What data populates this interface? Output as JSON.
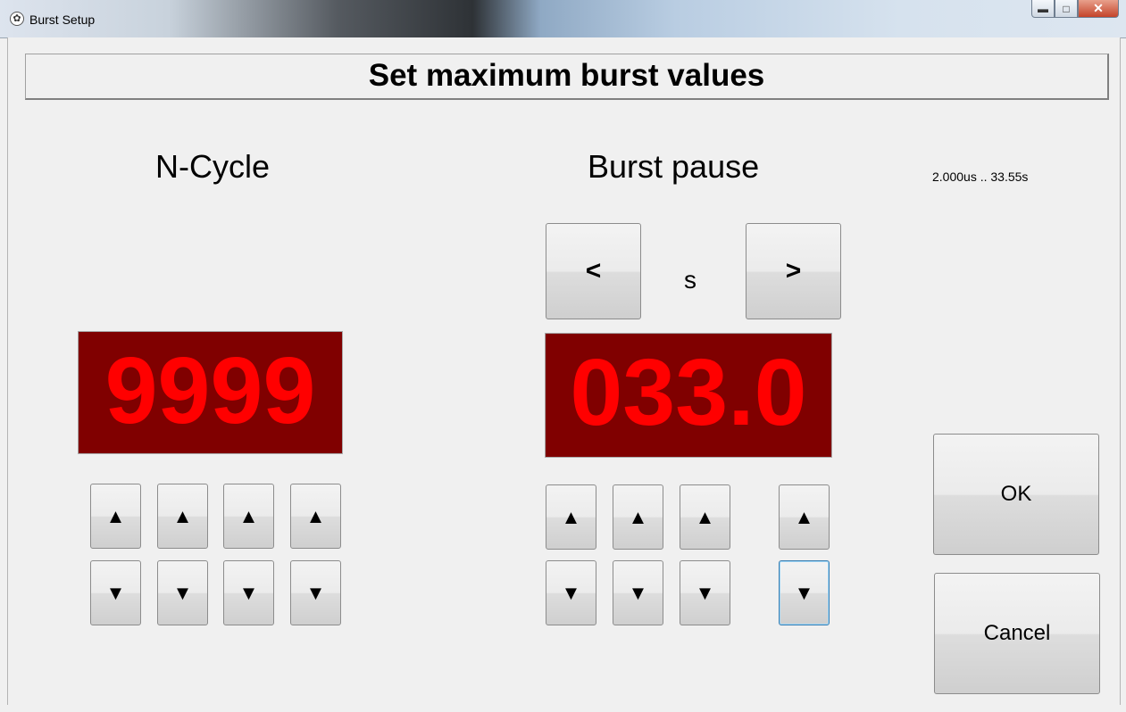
{
  "window": {
    "title": "Burst Setup"
  },
  "header": {
    "title": "Set maximum burst values"
  },
  "ncycle": {
    "label": "N-Cycle",
    "value": "9999"
  },
  "burst": {
    "label": "Burst pause",
    "unit": "s",
    "value": "033.0",
    "range": "2.000us .. 33.55s"
  },
  "buttons": {
    "prev": "<",
    "next": ">",
    "up": "▲",
    "down": "▼",
    "ok": "OK",
    "cancel": "Cancel"
  },
  "icons": {
    "app": "paw-icon",
    "minimize": "minimize-icon",
    "maximize": "maximize-icon",
    "close": "close-icon"
  },
  "colors": {
    "display_bg": "#800000",
    "display_fg": "#ff0000"
  }
}
